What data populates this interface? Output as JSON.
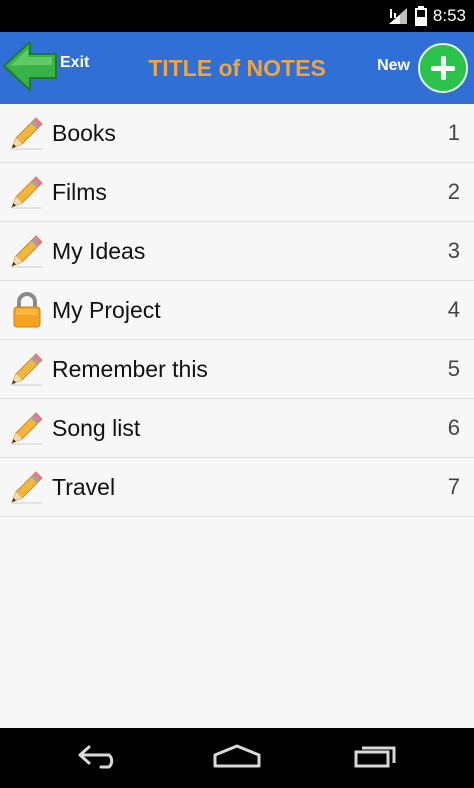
{
  "status_bar": {
    "time": "8:53",
    "icons": [
      "signal-icon",
      "battery-icon"
    ]
  },
  "header": {
    "exit_label": "Exit",
    "title": "TITLE of NOTES",
    "new_label": "New",
    "title_color": "#f2a33a",
    "bar_color": "#2f6fd6"
  },
  "notes": [
    {
      "title": "Books",
      "number": "1",
      "icon": "pencil-icon"
    },
    {
      "title": "Films",
      "number": "2",
      "icon": "pencil-icon"
    },
    {
      "title": "My Ideas",
      "number": "3",
      "icon": "pencil-icon"
    },
    {
      "title": "My Project",
      "number": "4",
      "icon": "lock-icon"
    },
    {
      "title": "Remember this",
      "number": "5",
      "icon": "pencil-icon"
    },
    {
      "title": "Song list",
      "number": "6",
      "icon": "pencil-icon"
    },
    {
      "title": "Travel",
      "number": "7",
      "icon": "pencil-icon"
    }
  ],
  "nav_bar": {
    "buttons": [
      "back-icon",
      "home-icon",
      "recent-apps-icon"
    ]
  }
}
